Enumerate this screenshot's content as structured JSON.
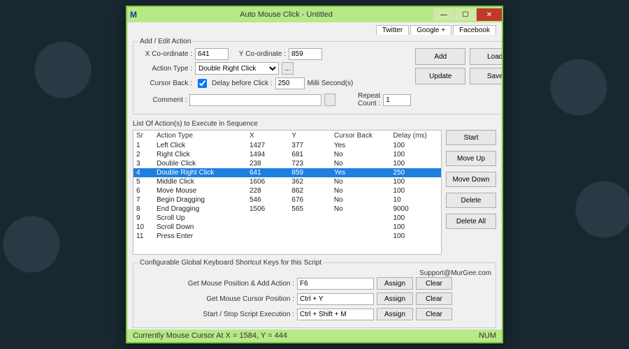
{
  "window": {
    "app_icon": "M",
    "title": "Auto Mouse Click - Untitled",
    "min": "—",
    "max": "☐",
    "close": "✕"
  },
  "top_tabs": [
    "Twitter",
    "Google +",
    "Facebook"
  ],
  "edit": {
    "legend": "Add / Edit Action",
    "x_label": "X Co-ordinate :",
    "x_value": "641",
    "y_label": "Y Co-ordinate :",
    "y_value": "859",
    "action_type_label": "Action Type :",
    "action_type_value": "Double Right Click",
    "more_btn": "...",
    "cursor_back_label": "Cursor Back :",
    "cursor_back_checked": true,
    "delay_label": "Delay before Click :",
    "delay_value": "250",
    "delay_unit": "Milli Second(s)",
    "comment_label": "Comment :",
    "comment_value": "",
    "repeat_label": "Repeat Count :",
    "repeat_value": "1",
    "add_btn": "Add",
    "load_btn": "Load",
    "update_btn": "Update",
    "save_btn": "Save"
  },
  "list": {
    "title": "List Of Action(s) to Execute in Sequence",
    "headers": [
      "Sr",
      "Action Type",
      "X",
      "Y",
      "Cursor Back",
      "Delay (ms)"
    ],
    "rows": [
      {
        "sr": "1",
        "type": "Left Click",
        "x": "1427",
        "y": "377",
        "cb": "Yes",
        "d": "100",
        "sel": false
      },
      {
        "sr": "2",
        "type": "Right Click",
        "x": "1494",
        "y": "681",
        "cb": "No",
        "d": "100",
        "sel": false
      },
      {
        "sr": "3",
        "type": "Double Click",
        "x": "238",
        "y": "723",
        "cb": "No",
        "d": "100",
        "sel": false
      },
      {
        "sr": "4",
        "type": "Double Right Click",
        "x": "641",
        "y": "859",
        "cb": "Yes",
        "d": "250",
        "sel": true
      },
      {
        "sr": "5",
        "type": "Middle Click",
        "x": "1606",
        "y": "362",
        "cb": "No",
        "d": "100",
        "sel": false
      },
      {
        "sr": "6",
        "type": "Move Mouse",
        "x": "228",
        "y": "862",
        "cb": "No",
        "d": "100",
        "sel": false
      },
      {
        "sr": "7",
        "type": "Begin Dragging",
        "x": "546",
        "y": "676",
        "cb": "No",
        "d": "10",
        "sel": false
      },
      {
        "sr": "8",
        "type": "End Dragging",
        "x": "1506",
        "y": "565",
        "cb": "No",
        "d": "9000",
        "sel": false
      },
      {
        "sr": "9",
        "type": "Scroll Up",
        "x": "",
        "y": "",
        "cb": "",
        "d": "100",
        "sel": false
      },
      {
        "sr": "10",
        "type": "Scroll Down",
        "x": "",
        "y": "",
        "cb": "",
        "d": "100",
        "sel": false
      },
      {
        "sr": "11",
        "type": "Press Enter",
        "x": "",
        "y": "",
        "cb": "",
        "d": "100",
        "sel": false
      }
    ],
    "side_buttons": [
      "Start",
      "Move Up",
      "Move Down",
      "Delete",
      "Delete All"
    ]
  },
  "shortcuts": {
    "legend": "Configurable Global Keyboard Shortcut Keys for this Script",
    "support": "Support@MurGee.com",
    "rows": [
      {
        "label": "Get Mouse Position & Add Action :",
        "value": "F6"
      },
      {
        "label": "Get Mouse Cursor Position :",
        "value": "Ctrl + Y"
      },
      {
        "label": "Start / Stop Script Execution :",
        "value": "Ctrl + Shift + M"
      }
    ],
    "assign_btn": "Assign",
    "clear_btn": "Clear"
  },
  "status": {
    "cursor": "Currently Mouse Cursor At X = 1584, Y = 444",
    "num": "NUM"
  }
}
